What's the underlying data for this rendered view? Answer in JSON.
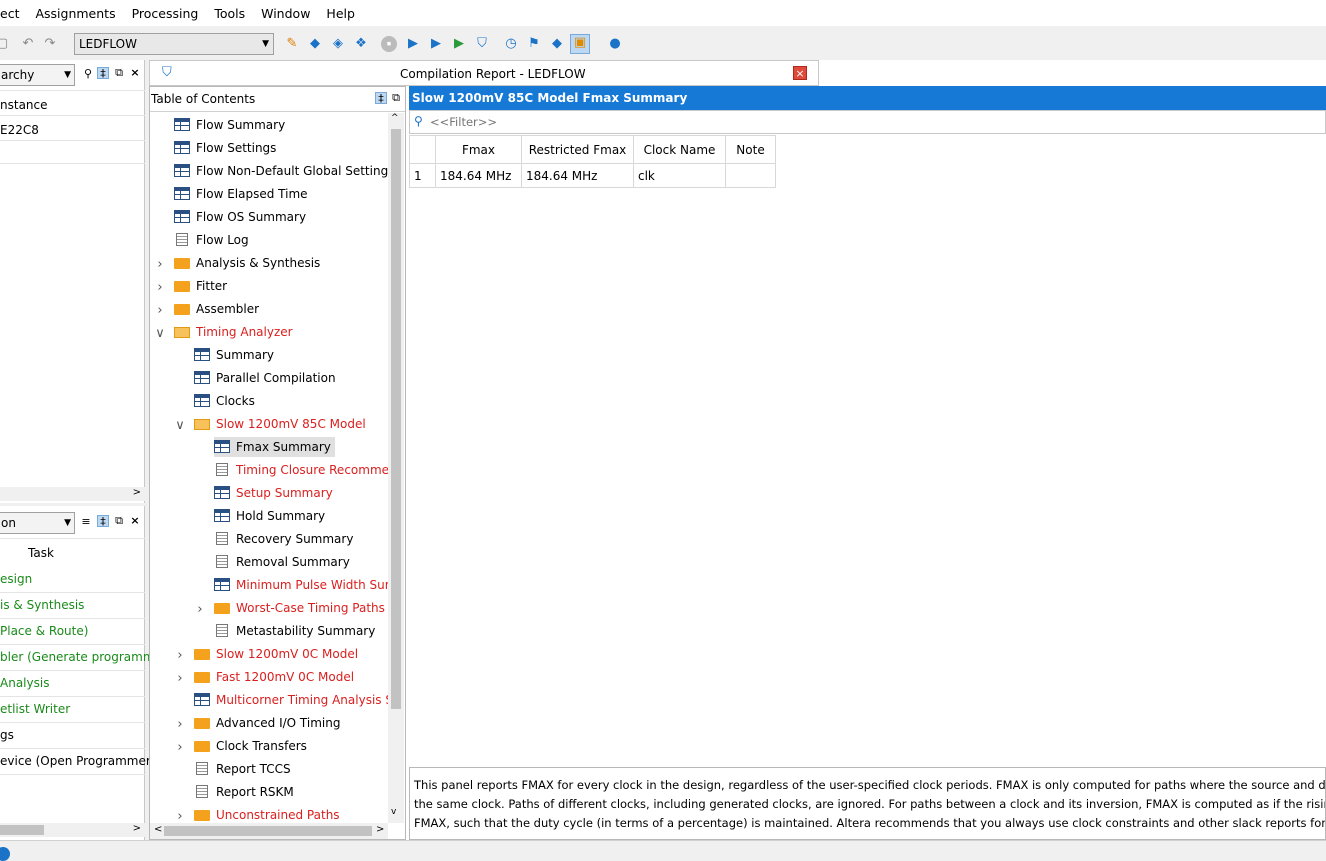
{
  "menu": [
    "ect",
    "Assignments",
    "Processing",
    "Tools",
    "Window",
    "Help"
  ],
  "toolbar": {
    "revision": "LEDFLOW",
    "icons": [
      "undo-icon",
      "redo-icon",
      "pencil-icon",
      "diamond-icon",
      "diamond-icon",
      "diamond-icon",
      "stop-icon",
      "play-icon",
      "play-check-icon",
      "play-green-icon",
      "shield-icon",
      "clock-icon",
      "network-icon",
      "diamond-check-icon",
      "chip-icon",
      "speech-icon"
    ]
  },
  "leftTop": {
    "combo": "archy",
    "rows": [
      "nstance",
      "E22C8"
    ]
  },
  "leftBottom": {
    "combo": "on",
    "header": "Task",
    "tasks": [
      {
        "label": "esign",
        "color": "#1a8a1a"
      },
      {
        "label": "is & Synthesis",
        "color": "#1a8a1a"
      },
      {
        "label": "Place & Route)",
        "color": "#1a8a1a"
      },
      {
        "label": "bler (Generate programmin",
        "color": "#1a8a1a"
      },
      {
        "label": " Analysis",
        "color": "#1a8a1a"
      },
      {
        "label": "etlist Writer",
        "color": "#1a8a1a"
      },
      {
        "label": "gs",
        "color": "#000000"
      },
      {
        "label": "evice (Open Programmer)",
        "color": "#000000"
      }
    ]
  },
  "report": {
    "title": "Compilation Report - LEDFLOW",
    "toc_title": "Table of Contents",
    "toc": [
      {
        "label": "Flow Summary",
        "icon": "table",
        "level": 0
      },
      {
        "label": "Flow Settings",
        "icon": "table",
        "level": 0
      },
      {
        "label": "Flow Non-Default Global Settings",
        "icon": "table",
        "level": 0
      },
      {
        "label": "Flow Elapsed Time",
        "icon": "table",
        "level": 0
      },
      {
        "label": "Flow OS Summary",
        "icon": "table",
        "level": 0
      },
      {
        "label": "Flow Log",
        "icon": "doc",
        "level": 0
      },
      {
        "label": "Analysis & Synthesis",
        "icon": "folder",
        "level": 0,
        "expander": ">"
      },
      {
        "label": "Fitter",
        "icon": "folder",
        "level": 0,
        "expander": ">"
      },
      {
        "label": "Assembler",
        "icon": "folder",
        "level": 0,
        "expander": ">"
      },
      {
        "label": "Timing Analyzer",
        "icon": "folder-open",
        "level": 0,
        "expander": "v",
        "red": true
      },
      {
        "label": "Summary",
        "icon": "table",
        "level": 1
      },
      {
        "label": "Parallel Compilation",
        "icon": "table",
        "level": 1
      },
      {
        "label": "Clocks",
        "icon": "table",
        "level": 1
      },
      {
        "label": "Slow 1200mV 85C Model",
        "icon": "folder-open",
        "level": 1,
        "expander": "v",
        "red": true
      },
      {
        "label": "Fmax Summary",
        "icon": "table",
        "level": 2,
        "selected": true
      },
      {
        "label": "Timing Closure Recommend",
        "icon": "doc",
        "level": 2,
        "red": true
      },
      {
        "label": "Setup Summary",
        "icon": "table",
        "level": 2,
        "red": true
      },
      {
        "label": "Hold Summary",
        "icon": "table",
        "level": 2
      },
      {
        "label": "Recovery Summary",
        "icon": "doc",
        "level": 2
      },
      {
        "label": "Removal Summary",
        "icon": "doc",
        "level": 2
      },
      {
        "label": "Minimum Pulse Width Summ",
        "icon": "table",
        "level": 2,
        "red": true
      },
      {
        "label": "Worst-Case Timing Paths",
        "icon": "folder",
        "level": 2,
        "expander": ">",
        "red": true
      },
      {
        "label": "Metastability Summary",
        "icon": "doc",
        "level": 2
      },
      {
        "label": "Slow 1200mV 0C Model",
        "icon": "folder",
        "level": 1,
        "expander": ">",
        "red": true
      },
      {
        "label": "Fast 1200mV 0C Model",
        "icon": "folder",
        "level": 1,
        "expander": ">",
        "red": true
      },
      {
        "label": "Multicorner Timing Analysis Sur",
        "icon": "table",
        "level": 1,
        "red": true
      },
      {
        "label": "Advanced I/O Timing",
        "icon": "folder",
        "level": 1,
        "expander": ">"
      },
      {
        "label": "Clock Transfers",
        "icon": "folder",
        "level": 1,
        "expander": ">"
      },
      {
        "label": "Report TCCS",
        "icon": "doc",
        "level": 1
      },
      {
        "label": "Report RSKM",
        "icon": "doc",
        "level": 1
      },
      {
        "label": "Unconstrained Paths",
        "icon": "folder",
        "level": 1,
        "expander": ">",
        "red": true
      }
    ],
    "section_title": "Slow 1200mV 85C Model Fmax Summary",
    "filter_placeholder": "<<Filter>>",
    "table": {
      "headers": [
        "",
        "Fmax",
        "Restricted Fmax",
        "Clock Name",
        "Note"
      ],
      "rows": [
        [
          "1",
          "184.64 MHz",
          "184.64 MHz",
          "clk",
          ""
        ]
      ]
    },
    "description": [
      "This panel reports FMAX for every clock in the design, regardless of the user-specified clock periods.  FMAX is only computed for paths where the source and destination re",
      "the same clock.  Paths of different clocks, including generated clocks, are ignored.  For paths between a clock and its inversion, FMAX is computed as if the rising and fallin",
      "FMAX, such that the duty cycle (in terms of a percentage) is maintained. Altera recommends that you always use clock constraints and other slack reports for sign-off analy"
    ]
  },
  "colors": {
    "header_blue": "#1779d6",
    "red_text": "#d9201f",
    "green_text": "#1a8a1a"
  }
}
